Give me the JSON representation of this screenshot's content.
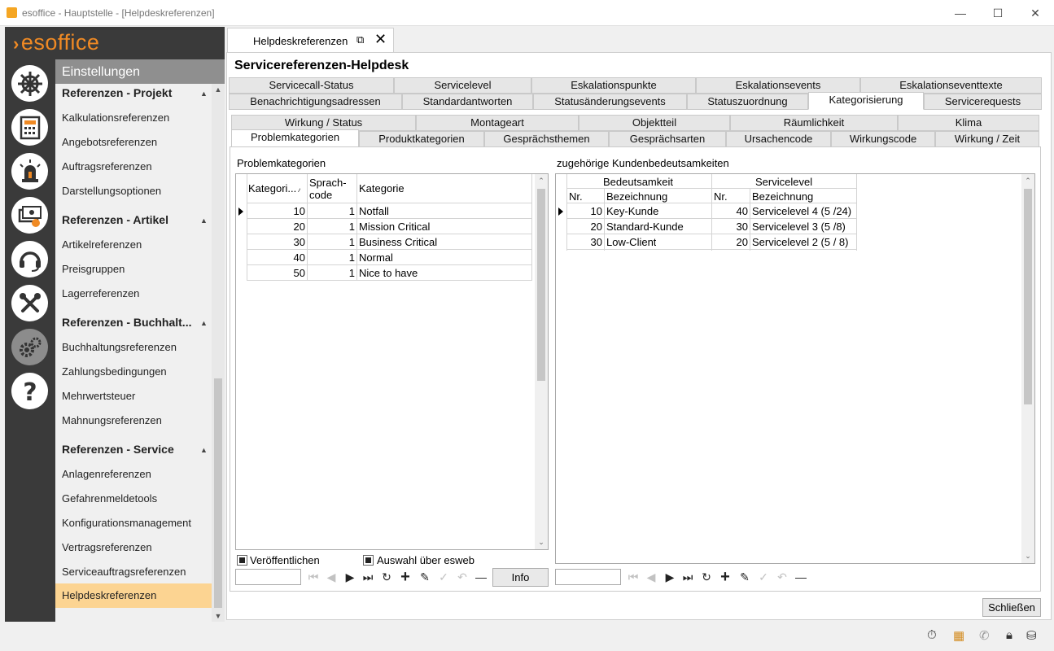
{
  "window": {
    "title": "esoffice - Hauptstelle - [Helpdeskreferenzen]",
    "min_glyph": "—",
    "max_glyph": "☐",
    "close_glyph": "✕"
  },
  "logo": "esoffice",
  "nav_icons": [
    "helm-icon",
    "calculator-icon",
    "alarm-light-icon",
    "cash-register-icon",
    "headset-icon",
    "tools-icon",
    "gears-icon",
    "help-icon"
  ],
  "settings": {
    "header": "Einstellungen",
    "sections": [
      {
        "title": "Referenzen - Projekt",
        "items": [
          "Kalkulationsreferenzen",
          "Angebotsreferenzen",
          "Auftragsreferenzen",
          "Darstellungsoptionen"
        ]
      },
      {
        "title": "Referenzen - Artikel",
        "items": [
          "Artikelreferenzen",
          "Preisgruppen",
          "Lagerreferenzen"
        ]
      },
      {
        "title": "Referenzen - Buchhalt...",
        "items": [
          "Buchhaltungsreferenzen",
          "Zahlungsbedingungen",
          "Mehrwertsteuer",
          "Mahnungsreferenzen"
        ]
      },
      {
        "title": "Referenzen - Service",
        "items": [
          "Anlagenreferenzen",
          "Gefahrenmeldetools",
          "Konfigurationsmanagement",
          "Vertragsreferenzen",
          "Serviceauftragsreferenzen",
          "Helpdeskreferenzen"
        ]
      }
    ],
    "active_item": "Helpdeskreferenzen"
  },
  "doc_tab": {
    "label": "Helpdeskreferenzen"
  },
  "doc_title": "Servicereferenzen-Helpdesk",
  "main_tabs_row1": [
    "Servicecall-Status",
    "Servicelevel",
    "Eskalationspunkte",
    "Eskalationsevents",
    "Eskalationseventtexte"
  ],
  "main_tabs_row2": [
    "Benachrichtigungsadressen",
    "Standardantworten",
    "Statusänderungsevents",
    "Statuszuordnung",
    "Kategorisierung",
    "Servicerequests"
  ],
  "main_tab_selected": "Kategorisierung",
  "sub_tabs_row1": [
    "Wirkung / Status",
    "Montageart",
    "Objektteil",
    "Räumlichkeit",
    "Klima"
  ],
  "sub_tabs_row2": [
    "Problemkategorien",
    "Produktkategorien",
    "Gesprächsthemen",
    "Gesprächsarten",
    "Ursachencode",
    "Wirkungscode",
    "Wirkung / Zeit"
  ],
  "sub_tab_selected": "Problemkategorien",
  "left_pane": {
    "label": "Problemkategorien",
    "columns": [
      "Kategori...",
      "Sprach-\ncode",
      "Kategorie"
    ],
    "sort_glyph": "⁄",
    "rows": [
      {
        "kat": "10",
        "sprach": "1",
        "kategorie": "Notfall"
      },
      {
        "kat": "20",
        "sprach": "1",
        "kategorie": "Mission Critical"
      },
      {
        "kat": "30",
        "sprach": "1",
        "kategorie": "Business Critical"
      },
      {
        "kat": "40",
        "sprach": "1",
        "kategorie": "Normal"
      },
      {
        "kat": "50",
        "sprach": "1",
        "kategorie": "Nice to have"
      }
    ],
    "check1": "Veröffentlichen",
    "check2": "Auswahl über esweb",
    "info_button": "Info"
  },
  "right_pane": {
    "label": "zugehörige Kundenbedeutsamkeiten",
    "group1": "Bedeutsamkeit",
    "group2": "Servicelevel",
    "columns": [
      "Nr.",
      "Bezeichnung",
      "Nr.",
      "Bezeichnung"
    ],
    "rows": [
      {
        "nr": "10",
        "bez": "Key-Kunde",
        "slnr": "40",
        "slbez": "Servicelevel 4 (5 /24)"
      },
      {
        "nr": "20",
        "bez": "Standard-Kunde",
        "slnr": "30",
        "slbez": "Servicelevel 3 (5 /8)"
      },
      {
        "nr": "30",
        "bez": "Low-Client",
        "slnr": "20",
        "slbez": "Servicelevel 2 (5 / 8)"
      }
    ]
  },
  "nav_glyphs": [
    "⏮",
    "◀",
    "▶",
    "⏭",
    "↻",
    "+",
    "✎",
    "✓",
    "↶",
    "—"
  ],
  "close_button": "Schließen",
  "status_icons": [
    "stopwatch-icon",
    "building-icon",
    "phone-icon",
    "lock-icon",
    "database-icon"
  ]
}
